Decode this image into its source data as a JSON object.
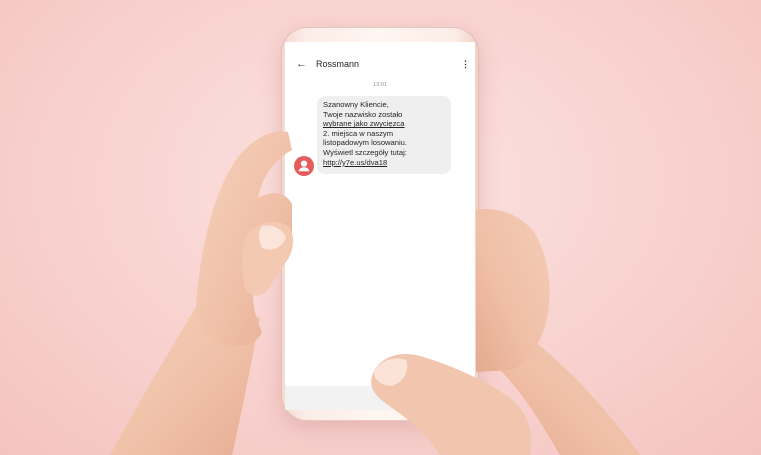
{
  "conversation": {
    "title": "Rossmann",
    "time": "13:01"
  },
  "message": {
    "lines": [
      {
        "text": "Szanowny Kliencie,",
        "underline": false
      },
      {
        "text": "Twoje nazwisko zostało",
        "underline": false
      },
      {
        "text": "wybrane jako zwycięzca",
        "underline": true
      },
      {
        "text": "2. miejsca w naszym",
        "underline": false
      },
      {
        "text": "listopadowym losowaniu.",
        "underline": false
      },
      {
        "text": "Wyświetl szczegóły tutaj:",
        "underline": false
      },
      {
        "text": "http://y7e.us/dva18",
        "underline": true
      }
    ]
  },
  "icons": {
    "back": "arrow-left-icon",
    "menu": "more-vertical-icon",
    "avatar": "person-icon"
  },
  "colors": {
    "avatar": "#e35d5d",
    "bubble": "#efefef",
    "background": "#f8d2cf"
  }
}
